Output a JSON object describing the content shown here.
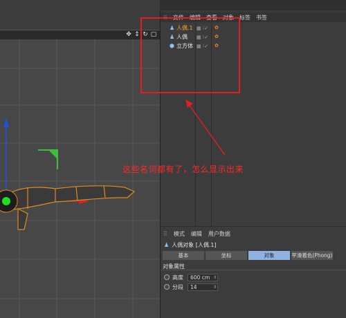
{
  "object_manager": {
    "menu": [
      "文件",
      "编辑",
      "查看",
      "对象",
      "标签",
      "书签"
    ],
    "objects": [
      {
        "name": "人偶.1",
        "icon": "figure-icon",
        "selected": true
      },
      {
        "name": "人偶",
        "icon": "figure-icon",
        "selected": false
      },
      {
        "name": "立方体",
        "icon": "cube-icon",
        "selected": false
      }
    ]
  },
  "attribute_manager": {
    "menu": [
      "模式",
      "编辑",
      "用户数据"
    ],
    "title": "人偶对象 [人偶.1]",
    "tabs": [
      "基本",
      "坐标",
      "对象",
      "平滑着色(Phong)"
    ],
    "active_tab": "对象",
    "section": "对象属性",
    "fields": [
      {
        "label": "高度",
        "value": "600 cm"
      },
      {
        "label": "分段",
        "value": "14"
      }
    ]
  },
  "annotation": {
    "text": "这些名词都有了，怎么显示出来",
    "color": "#e02020"
  },
  "colors": {
    "selected_text": "#f5a623",
    "active_tab": "#8fb2e0",
    "axis_y": "#2050e0",
    "axis_x": "#e02020",
    "figure_outline": "#e08a20"
  }
}
